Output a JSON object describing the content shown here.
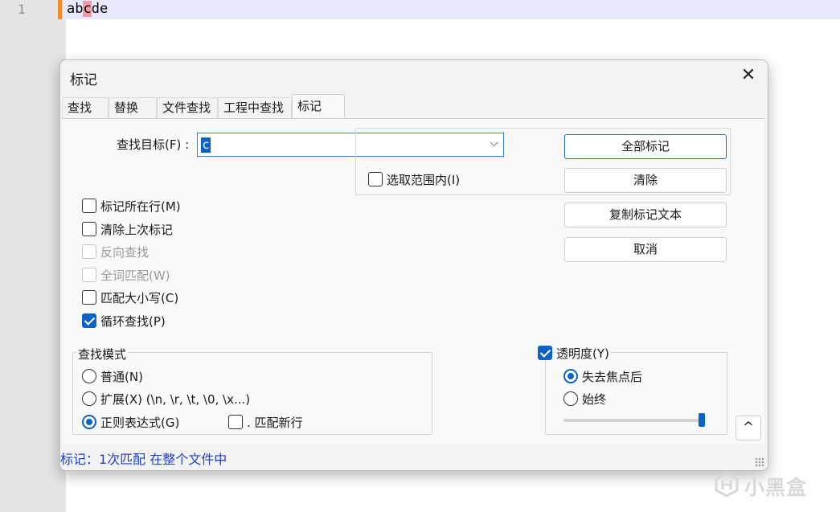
{
  "editor": {
    "line_number": "1",
    "text_before": "ab",
    "text_highlight": "c",
    "text_after": "de"
  },
  "dialog": {
    "title": "标记",
    "tabs": [
      "查找",
      "替换",
      "文件查找",
      "工程中查找",
      "标记"
    ],
    "active_tab": "标记",
    "find_label": "查找目标(F) :",
    "find_value": "c",
    "scope_checkbox": {
      "label": "选取范围内(I)",
      "checked": false
    },
    "buttons": {
      "mark_all": "全部标记",
      "clear": "清除",
      "copy_marked": "复制标记文本",
      "cancel": "取消"
    },
    "options": [
      {
        "label": "标记所在行(M)",
        "checked": false,
        "enabled": true
      },
      {
        "label": "清除上次标记",
        "checked": false,
        "enabled": true
      },
      {
        "label": "反向查找",
        "checked": false,
        "enabled": false
      },
      {
        "label": "全词匹配(W)",
        "checked": false,
        "enabled": false
      },
      {
        "label": "匹配大小写(C)",
        "checked": false,
        "enabled": true
      },
      {
        "label": "循环查找(P)",
        "checked": true,
        "enabled": true
      }
    ],
    "search_mode": {
      "title": "查找模式",
      "normal": "普通(N)",
      "extended": "扩展(X) (\\n, \\r, \\t, \\0, \\x...)",
      "regex": "正则表达式(G)",
      "selected": "regex",
      "dot_newline": {
        "label": ". 匹配新行",
        "checked": false
      }
    },
    "transparency": {
      "label": "透明度(Y)",
      "checked": true,
      "on_lose_focus": "失去焦点后",
      "always": "始终",
      "selected": "on_lose_focus",
      "level": 0.97
    },
    "up_button": "^",
    "status": "标记：1次匹配 在整个文件中"
  },
  "watermark": {
    "text": "小黑盒"
  },
  "colors": {
    "accent": "#0b63c7",
    "highlight": "#f19ca4",
    "status_text": "#1f3fbf",
    "change_bar": "#f08a2a"
  }
}
